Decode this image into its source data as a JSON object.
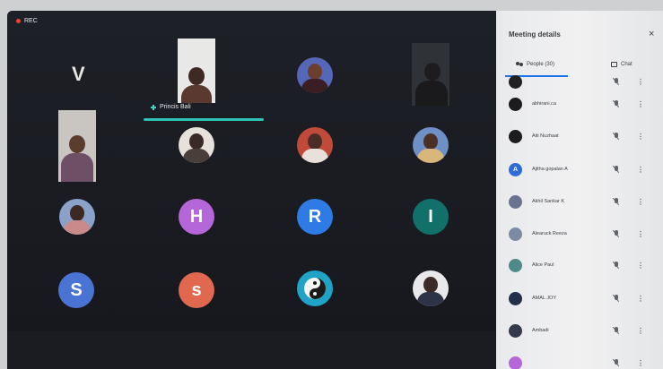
{
  "recording": {
    "label": "REC"
  },
  "speaker": {
    "name": "Princis Bali"
  },
  "tiles": [
    {
      "type": "letter-plain",
      "letter": "V"
    },
    {
      "type": "letter",
      "letter": "H",
      "color": "#b566d8"
    },
    {
      "type": "letter",
      "letter": "R",
      "color": "#2f7be5"
    },
    {
      "type": "letter",
      "letter": "I",
      "color": "#11706a"
    },
    {
      "type": "letter",
      "letter": "S",
      "color": "#4a74d4"
    },
    {
      "type": "letter",
      "letter": "s",
      "color": "#e0684f"
    }
  ],
  "panel": {
    "title": "Meeting details",
    "tabs": {
      "people": "People (30)",
      "chat": "Chat"
    },
    "close_label": "×",
    "more_glyph": "⋮",
    "participants": [
      {
        "name": "",
        "avatar_color": "#222",
        "initial": ""
      },
      {
        "name": "abhirani.ca",
        "avatar_color": "#1c1c1c",
        "initial": ""
      },
      {
        "name": "Aiti Nuzhaat",
        "avatar_color": "#1c1c1c",
        "initial": ""
      },
      {
        "name": "Ajitha gopalan A",
        "avatar_color": "#2f6bd6",
        "initial": "A"
      },
      {
        "name": "Akhil Sankar K",
        "avatar_color": "#6a7490",
        "initial": ""
      },
      {
        "name": "Alearuck Reeza",
        "avatar_color": "#7b8aa5",
        "initial": ""
      },
      {
        "name": "Alice Paul",
        "avatar_color": "#4f8a8a",
        "initial": ""
      },
      {
        "name": "AMAL JOY",
        "avatar_color": "#23304d",
        "initial": ""
      },
      {
        "name": "Ambadi",
        "avatar_color": "#353a4a",
        "initial": ""
      },
      {
        "name": "",
        "avatar_color": "#b566d8",
        "initial": ""
      }
    ]
  }
}
